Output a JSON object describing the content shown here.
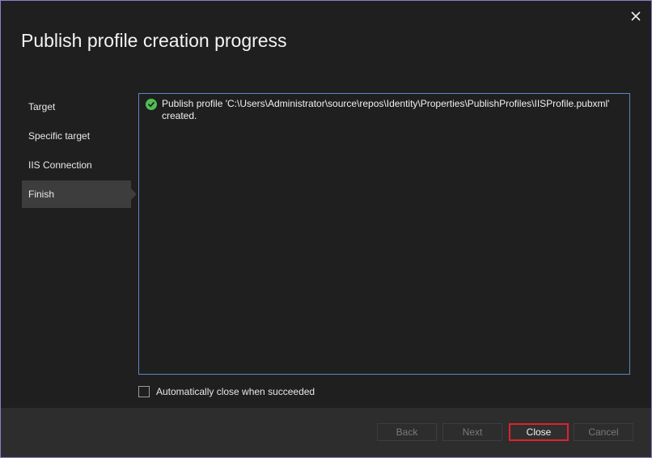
{
  "dialog": {
    "title": "Publish profile creation progress",
    "close_icon": "close-icon"
  },
  "nav": {
    "items": [
      {
        "label": "Target",
        "active": false
      },
      {
        "label": "Specific target",
        "active": false
      },
      {
        "label": "IIS Connection",
        "active": false
      },
      {
        "label": "Finish",
        "active": true
      }
    ]
  },
  "output": {
    "status_icon": "success-check-icon",
    "status_color": "#4fbf52",
    "message": "Publish profile 'C:\\Users\\Administrator\\source\\repos\\Identity\\Properties\\PublishProfiles\\IISProfile.pubxml'\ncreated."
  },
  "auto_close": {
    "label": "Automatically close when succeeded",
    "checked": false
  },
  "buttons": {
    "back": "Back",
    "next": "Next",
    "close": "Close",
    "cancel": "Cancel"
  },
  "colors": {
    "accent_border": "#5b87c4",
    "focus_border": "#e0222c",
    "window_border": "#8a80c8"
  }
}
